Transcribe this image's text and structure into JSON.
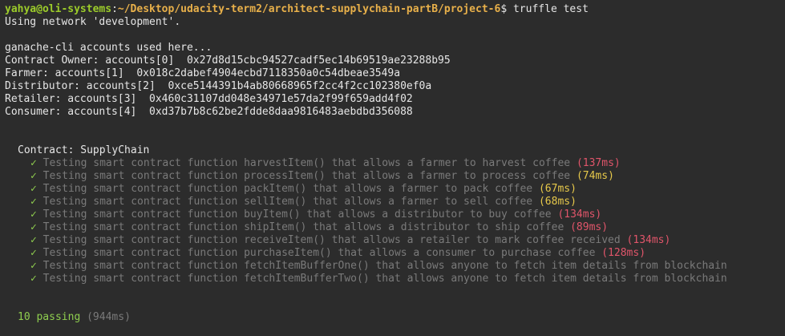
{
  "prompt": {
    "user_host": "yahya@oli-systems",
    "separator": ":",
    "path": "~/Desktop/udacity-term2/architect-supplychain-partB/project-6",
    "symbol": "$",
    "command": " truffle test"
  },
  "network_line": "Using network 'development'.",
  "accounts_header": "ganache-cli accounts used here...",
  "accounts": [
    {
      "text": "Contract Owner: accounts[0]  0x27d8d15cbc94527cadf5ec14b69519ae23288b95"
    },
    {
      "text": "Farmer: accounts[1]  0x018c2dabef4904ecbd7118350a0c54dbeae3549a"
    },
    {
      "text": "Distributor: accounts[2]  0xce5144391b4ab80668965f2cc4f2cc102380ef0a"
    },
    {
      "text": "Retailer: accounts[3]  0x460c31107dd048e34971e57da2f99f659add4f02"
    },
    {
      "text": "Consumer: accounts[4]  0xd37b7b8c62be2fdde8daa9816483aebdbd356088"
    }
  ],
  "suite": {
    "title": "Contract: SupplyChain",
    "check_symbol": "✓",
    "tests": [
      {
        "text": "Testing smart contract function harvestItem() that allows a farmer to harvest coffee",
        "duration": "(137ms)",
        "speed": "slow"
      },
      {
        "text": "Testing smart contract function processItem() that allows a farmer to process coffee",
        "duration": "(74ms)",
        "speed": "medium"
      },
      {
        "text": "Testing smart contract function packItem() that allows a farmer to pack coffee",
        "duration": "(67ms)",
        "speed": "medium"
      },
      {
        "text": "Testing smart contract function sellItem() that allows a farmer to sell coffee",
        "duration": "(68ms)",
        "speed": "medium"
      },
      {
        "text": "Testing smart contract function buyItem() that allows a distributor to buy coffee",
        "duration": "(134ms)",
        "speed": "slow"
      },
      {
        "text": "Testing smart contract function shipItem() that allows a distributor to ship coffee",
        "duration": "(89ms)",
        "speed": "slow"
      },
      {
        "text": "Testing smart contract function receiveItem() that allows a retailer to mark coffee received",
        "duration": "(134ms)",
        "speed": "slow"
      },
      {
        "text": "Testing smart contract function purchaseItem() that allows a consumer to purchase coffee",
        "duration": "(128ms)",
        "speed": "slow"
      },
      {
        "text": "Testing smart contract function fetchItemBufferOne() that allows anyone to fetch item details from blockchain",
        "duration": "",
        "speed": "none"
      },
      {
        "text": "Testing smart contract function fetchItemBufferTwo() that allows anyone to fetch item details from blockchain",
        "duration": "",
        "speed": "none"
      }
    ]
  },
  "summary": {
    "passing": "10 passing",
    "time": "(944ms)"
  },
  "colors": {
    "background": "#2c2c2c",
    "user_host": "#9ccc2a",
    "path": "#e8b04a",
    "check": "#8fce4f",
    "slow": "#e0556a",
    "medium": "#e6c84a",
    "muted": "#7a7a7a"
  }
}
